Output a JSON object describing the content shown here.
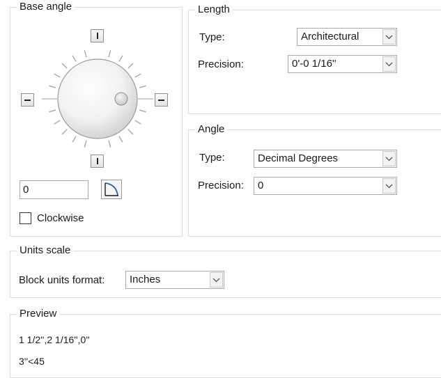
{
  "base_angle": {
    "title": "Base angle",
    "angle_value": "0",
    "clockwise_label": "Clockwise",
    "clockwise_checked": false,
    "icons": {
      "north": "bar-vertical-icon",
      "south": "bar-vertical-icon",
      "west": "bar-horizontal-icon",
      "east": "bar-horizontal-icon",
      "pick": "pick-angle-icon"
    }
  },
  "length": {
    "title": "Length",
    "type_label": "Type:",
    "type_value": "Architectural",
    "precision_label": "Precision:",
    "precision_value": "0'-0 1/16''"
  },
  "angle": {
    "title": "Angle",
    "type_label": "Type:",
    "type_value": "Decimal Degrees",
    "precision_label": "Precision:",
    "precision_value": "0"
  },
  "units_scale": {
    "title": "Units scale",
    "block_units_label": "Block units format:",
    "block_units_value": "Inches"
  },
  "preview": {
    "title": "Preview",
    "lines": [
      "1 1/2'',2 1/16'',0''",
      "3''<45"
    ]
  },
  "colors": {
    "border": "#dcdcdc",
    "combo_border": "#a9a9a9",
    "text": "#1a1a1a",
    "pick_arc": "#1f5fbf"
  }
}
